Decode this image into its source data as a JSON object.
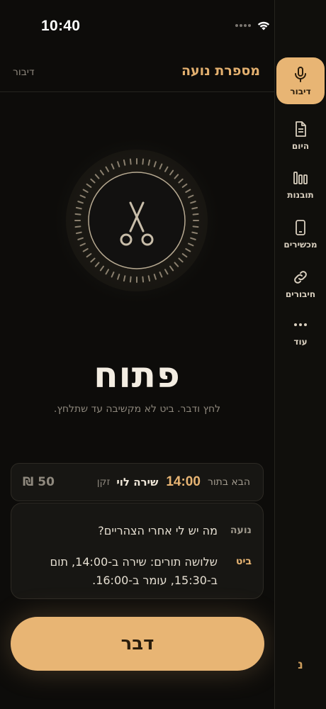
{
  "status_bar": {
    "time": "10:40"
  },
  "header": {
    "title": "מספרת נועה",
    "mode": "דיבור"
  },
  "assistant": {
    "state": "פתוח",
    "hint": "לחץ ודבר. ביט לא מקשיבה עד שתלחץ."
  },
  "next_appointment": {
    "label": "הבא בתור",
    "time": "14:00",
    "client": "שירה לוי",
    "service": "זקן",
    "price": "50 ₪"
  },
  "conversation": [
    {
      "speaker": "נועה",
      "text": "מה יש לי אחרי הצהריים?"
    },
    {
      "speaker": "ביט",
      "text": "שלושה תורים: שירה ב-14:00, תום ב-15:30, עומר ב-16:00."
    }
  ],
  "talk_button": {
    "label": "דבר"
  },
  "rail": {
    "items": [
      {
        "label": "דיבור",
        "icon": "mic-icon",
        "active": true
      },
      {
        "label": "היום",
        "icon": "document-icon"
      },
      {
        "label": "תובנות",
        "icon": "bars-icon"
      },
      {
        "label": "מכשירים",
        "icon": "phone-icon"
      },
      {
        "label": "חיבורים",
        "icon": "link-icon"
      },
      {
        "label": "עוד",
        "icon": "more-icon"
      }
    ],
    "footer_letter": "נ"
  },
  "colors": {
    "accent": "#e8b574",
    "background": "#0d0c0a",
    "card": "#171613"
  }
}
